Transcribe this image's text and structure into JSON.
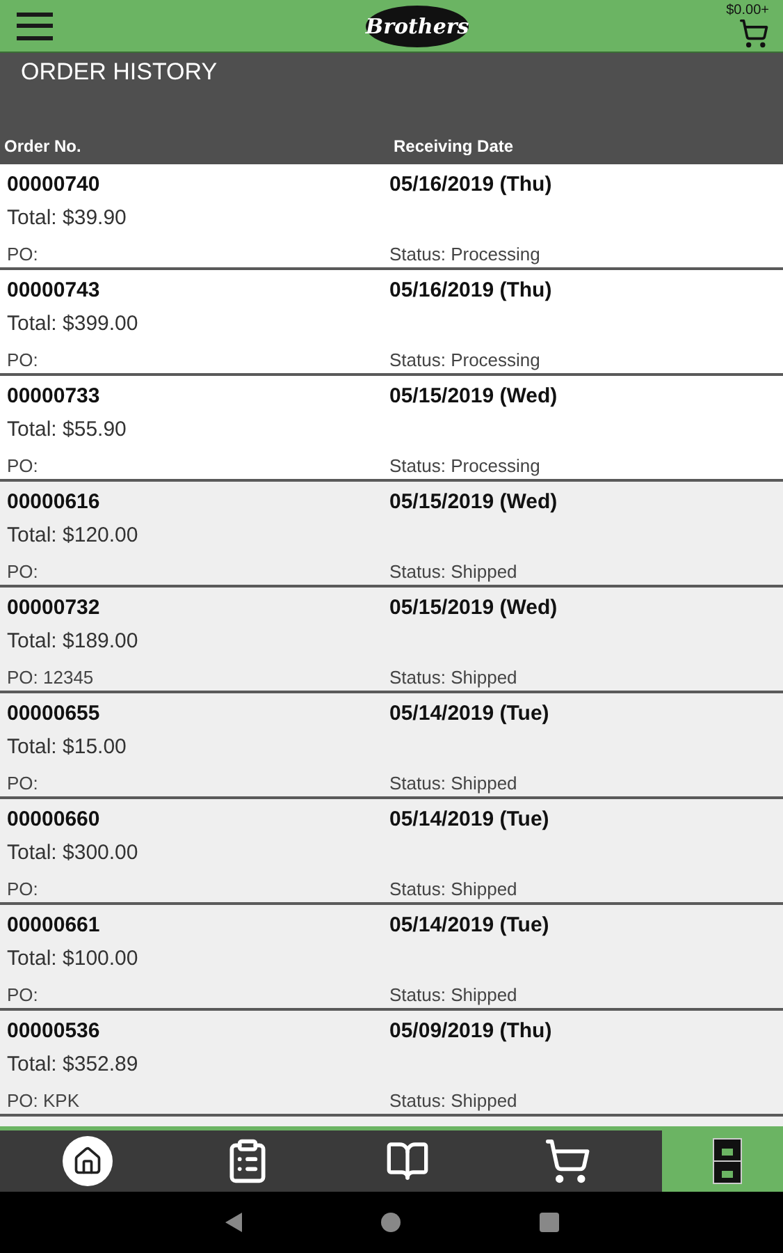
{
  "header": {
    "logo": "Brothers",
    "cart_total": "$0.00+"
  },
  "page_title": "ORDER HISTORY",
  "columns": [
    "Order No.",
    "Receiving Date"
  ],
  "orders": [
    {
      "number": "00000740",
      "total": "Total: $39.90",
      "po": "PO:",
      "date": "05/16/2019 (Thu)",
      "status": "Status: Processing",
      "kind": "processing"
    },
    {
      "number": "00000743",
      "total": "Total: $399.00",
      "po": "PO:",
      "date": "05/16/2019 (Thu)",
      "status": "Status: Processing",
      "kind": "processing"
    },
    {
      "number": "00000733",
      "total": "Total: $55.90",
      "po": "PO:",
      "date": "05/15/2019 (Wed)",
      "status": "Status: Processing",
      "kind": "processing"
    },
    {
      "number": "00000616",
      "total": "Total: $120.00",
      "po": "PO:",
      "date": "05/15/2019 (Wed)",
      "status": "Status: Shipped",
      "kind": "shipped"
    },
    {
      "number": "00000732",
      "total": "Total: $189.00",
      "po": "PO: 12345",
      "date": "05/15/2019 (Wed)",
      "status": "Status: Shipped",
      "kind": "shipped"
    },
    {
      "number": "00000655",
      "total": "Total: $15.00",
      "po": "PO:",
      "date": "05/14/2019 (Tue)",
      "status": "Status: Shipped",
      "kind": "shipped"
    },
    {
      "number": "00000660",
      "total": "Total: $300.00",
      "po": "PO:",
      "date": "05/14/2019 (Tue)",
      "status": "Status: Shipped",
      "kind": "shipped"
    },
    {
      "number": "00000661",
      "total": "Total: $100.00",
      "po": "PO:",
      "date": "05/14/2019 (Tue)",
      "status": "Status: Shipped",
      "kind": "shipped"
    },
    {
      "number": "00000536",
      "total": "Total: $352.89",
      "po": "PO: KPK",
      "date": "05/09/2019 (Thu)",
      "status": "Status: Shipped",
      "kind": "shipped"
    }
  ],
  "bottom_tabs": [
    {
      "kind": "home",
      "selected": false
    },
    {
      "kind": "orders",
      "selected": false
    },
    {
      "kind": "catalog",
      "selected": false
    },
    {
      "kind": "cart",
      "selected": false
    },
    {
      "kind": "history",
      "selected": true
    }
  ]
}
